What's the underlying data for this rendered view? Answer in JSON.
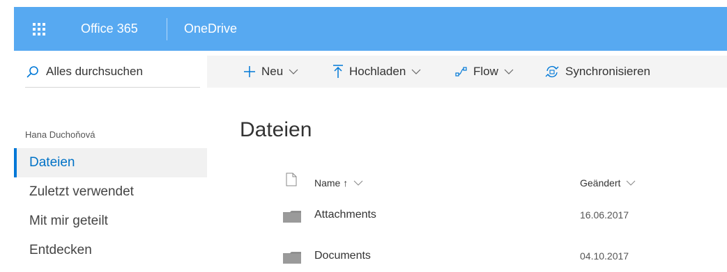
{
  "suite_bar": {
    "brand": "Office 365",
    "app_name": "OneDrive",
    "color": "#57a9f1"
  },
  "left_nav": {
    "search_label": "Alles durchsuchen",
    "owner_name": "Hana Duchoňová",
    "items": [
      {
        "label": "Dateien",
        "active": true
      },
      {
        "label": "Zuletzt verwendet",
        "active": false
      },
      {
        "label": "Mit mir geteilt",
        "active": false
      },
      {
        "label": "Entdecken",
        "active": false
      }
    ]
  },
  "command_bar": {
    "new_label": "Neu",
    "upload_label": "Hochladen",
    "flow_label": "Flow",
    "sync_label": "Synchronisieren"
  },
  "main": {
    "title": "Dateien",
    "columns": {
      "name": "Name ↑",
      "modified": "Geändert"
    },
    "rows": [
      {
        "name": "Attachments",
        "modified": "16.06.2017",
        "icon": "folder-icon"
      },
      {
        "name": "Documents",
        "modified": "04.10.2017",
        "icon": "folder-icon"
      }
    ]
  },
  "colors": {
    "accent": "#0078d7",
    "link_active": "#0072c6",
    "command_bar_bg": "#f4f4f4"
  }
}
